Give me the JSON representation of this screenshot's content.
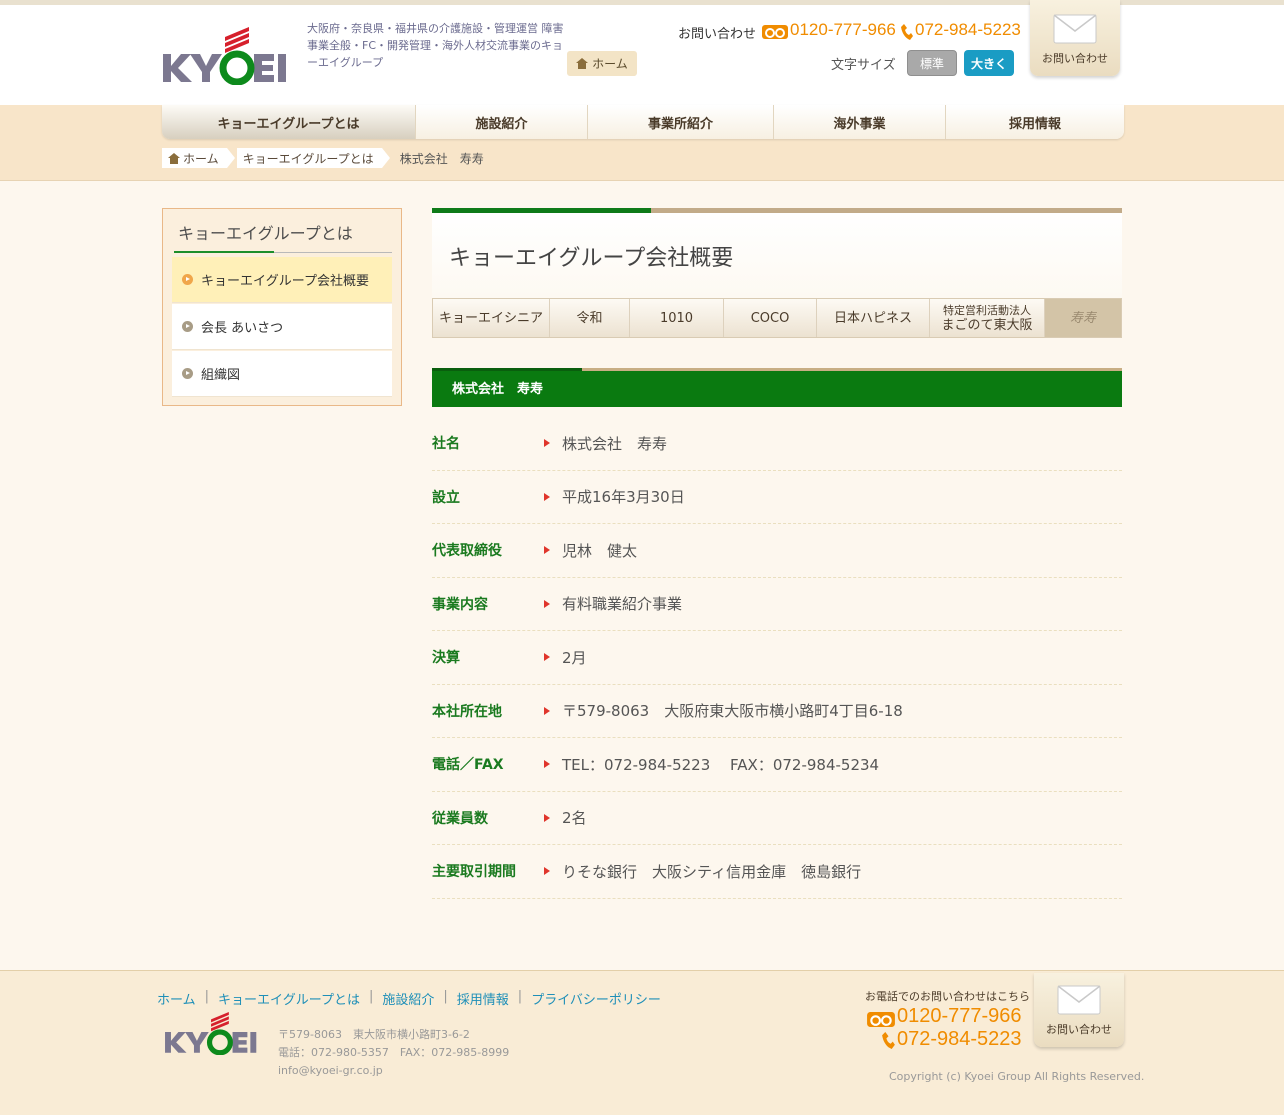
{
  "header": {
    "tagline": "大阪府・奈良県・福井県の介護施設・管理運営 障害事業全般・FC・開発管理・海外人材交流事業のキョーエイグループ",
    "home_button": "ホーム",
    "contact_label": "お問い合わせ",
    "freedial_number": "0120-777-966",
    "phone_number": "072-984-5223",
    "fontsize_label": "文字サイズ",
    "fontsize_standard": "標準",
    "fontsize_large": "大きく",
    "inquiry_button": "お問い合わせ"
  },
  "nav": {
    "items": [
      "キョーエイグループとは",
      "施設紹介",
      "事業所紹介",
      "海外事業",
      "採用情報"
    ]
  },
  "breadcrumb": [
    "ホーム",
    "キョーエイグループとは",
    "株式会社　寿寿"
  ],
  "sidebar": {
    "title": "キョーエイグループとは",
    "items": [
      "キョーエイグループ会社概要",
      "会長 あいさつ",
      "組織図"
    ]
  },
  "main": {
    "title": "キョーエイグループ会社概要",
    "tabs": [
      {
        "label": "キョーエイシニア"
      },
      {
        "label": "令和"
      },
      {
        "label": "1010"
      },
      {
        "label": "COCO"
      },
      {
        "label": "日本ハピネス"
      },
      {
        "label": "特定営利活動法人",
        "label2": "まごのて東大阪"
      },
      {
        "label": "寿寿"
      }
    ],
    "company_header": "株式会社　寿寿",
    "rows": [
      {
        "label": "社名",
        "value": "株式会社　寿寿"
      },
      {
        "label": "設立",
        "value": "平成16年3月30日"
      },
      {
        "label": "代表取締役",
        "value": "児林　健太"
      },
      {
        "label": "事業内容",
        "value": "有料職業紹介事業"
      },
      {
        "label": "決算",
        "value": "2月"
      },
      {
        "label": "本社所在地",
        "value": "〒579-8063　大阪府東大阪市横小路町4丁目6-18"
      },
      {
        "label": "電話／FAX",
        "value": "TEL：072-984-5223　 FAX：072-984-5234"
      },
      {
        "label": "従業員数",
        "value": "2名"
      },
      {
        "label": "主要取引期間",
        "value": "りそな銀行　大阪シティ信用金庫　徳島銀行"
      }
    ]
  },
  "footer": {
    "links": [
      "ホーム",
      "キョーエイグループとは",
      "施設紹介",
      "採用情報",
      "プライバシーポリシー"
    ],
    "address_line1": "〒579-8063　東大阪市横小路町3-6-2",
    "address_line2": "電話：072-980-5357　FAX：072-985-8999",
    "email": "info@kyoei-gr.co.jp",
    "contact_label": "お電話でのお問い合わせはこちら",
    "freedial_number": "0120-777-966",
    "phone_number": "072-984-5223",
    "inquiry_button": "お問い合わせ",
    "copyright": "Copyright (c) Kyoei Group All Rights Reserved."
  },
  "colors": {
    "brand_red": "#d6202c",
    "brand_green": "#0a7a10",
    "accent_orange": "#f08c00",
    "link_blue": "#1e8fb8"
  }
}
